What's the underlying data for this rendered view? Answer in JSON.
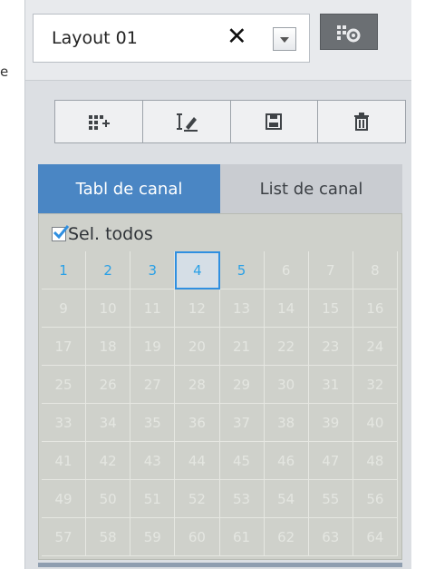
{
  "edge_fragment": "e",
  "layout": {
    "name": "Layout 01",
    "clear_glyph": "✕"
  },
  "toolbar": {
    "buttons": [
      {
        "icon": "add-layout-icon"
      },
      {
        "icon": "rename-icon"
      },
      {
        "icon": "save-icon"
      },
      {
        "icon": "delete-icon"
      }
    ]
  },
  "tabs": {
    "active": "Tabl de canal",
    "inactive": "List de canal"
  },
  "select_all": {
    "label": "Sel. todos",
    "checked": true
  },
  "channels": [
    {
      "n": "1",
      "on": true
    },
    {
      "n": "2",
      "on": true
    },
    {
      "n": "3",
      "on": true
    },
    {
      "n": "4",
      "on": true,
      "focus": true
    },
    {
      "n": "5",
      "on": true
    },
    {
      "n": "6"
    },
    {
      "n": "7"
    },
    {
      "n": "8"
    },
    {
      "n": "9"
    },
    {
      "n": "10"
    },
    {
      "n": "11"
    },
    {
      "n": "12"
    },
    {
      "n": "13"
    },
    {
      "n": "14"
    },
    {
      "n": "15"
    },
    {
      "n": "16"
    },
    {
      "n": "17"
    },
    {
      "n": "18"
    },
    {
      "n": "19"
    },
    {
      "n": "20"
    },
    {
      "n": "21"
    },
    {
      "n": "22"
    },
    {
      "n": "23"
    },
    {
      "n": "24"
    },
    {
      "n": "25"
    },
    {
      "n": "26"
    },
    {
      "n": "27"
    },
    {
      "n": "28"
    },
    {
      "n": "29"
    },
    {
      "n": "30"
    },
    {
      "n": "31"
    },
    {
      "n": "32"
    },
    {
      "n": "33"
    },
    {
      "n": "34"
    },
    {
      "n": "35"
    },
    {
      "n": "36"
    },
    {
      "n": "37"
    },
    {
      "n": "38"
    },
    {
      "n": "39"
    },
    {
      "n": "40"
    },
    {
      "n": "41"
    },
    {
      "n": "42"
    },
    {
      "n": "43"
    },
    {
      "n": "44"
    },
    {
      "n": "45"
    },
    {
      "n": "46"
    },
    {
      "n": "47"
    },
    {
      "n": "48"
    },
    {
      "n": "49"
    },
    {
      "n": "50"
    },
    {
      "n": "51"
    },
    {
      "n": "52"
    },
    {
      "n": "53"
    },
    {
      "n": "54"
    },
    {
      "n": "55"
    },
    {
      "n": "56"
    },
    {
      "n": "57"
    },
    {
      "n": "58"
    },
    {
      "n": "59"
    },
    {
      "n": "60"
    },
    {
      "n": "61"
    },
    {
      "n": "62"
    },
    {
      "n": "63"
    },
    {
      "n": "64"
    }
  ],
  "colors": {
    "accent": "#4a86c4",
    "channel_active": "#2aa0e6",
    "focus_border": "#2f8fe0"
  }
}
